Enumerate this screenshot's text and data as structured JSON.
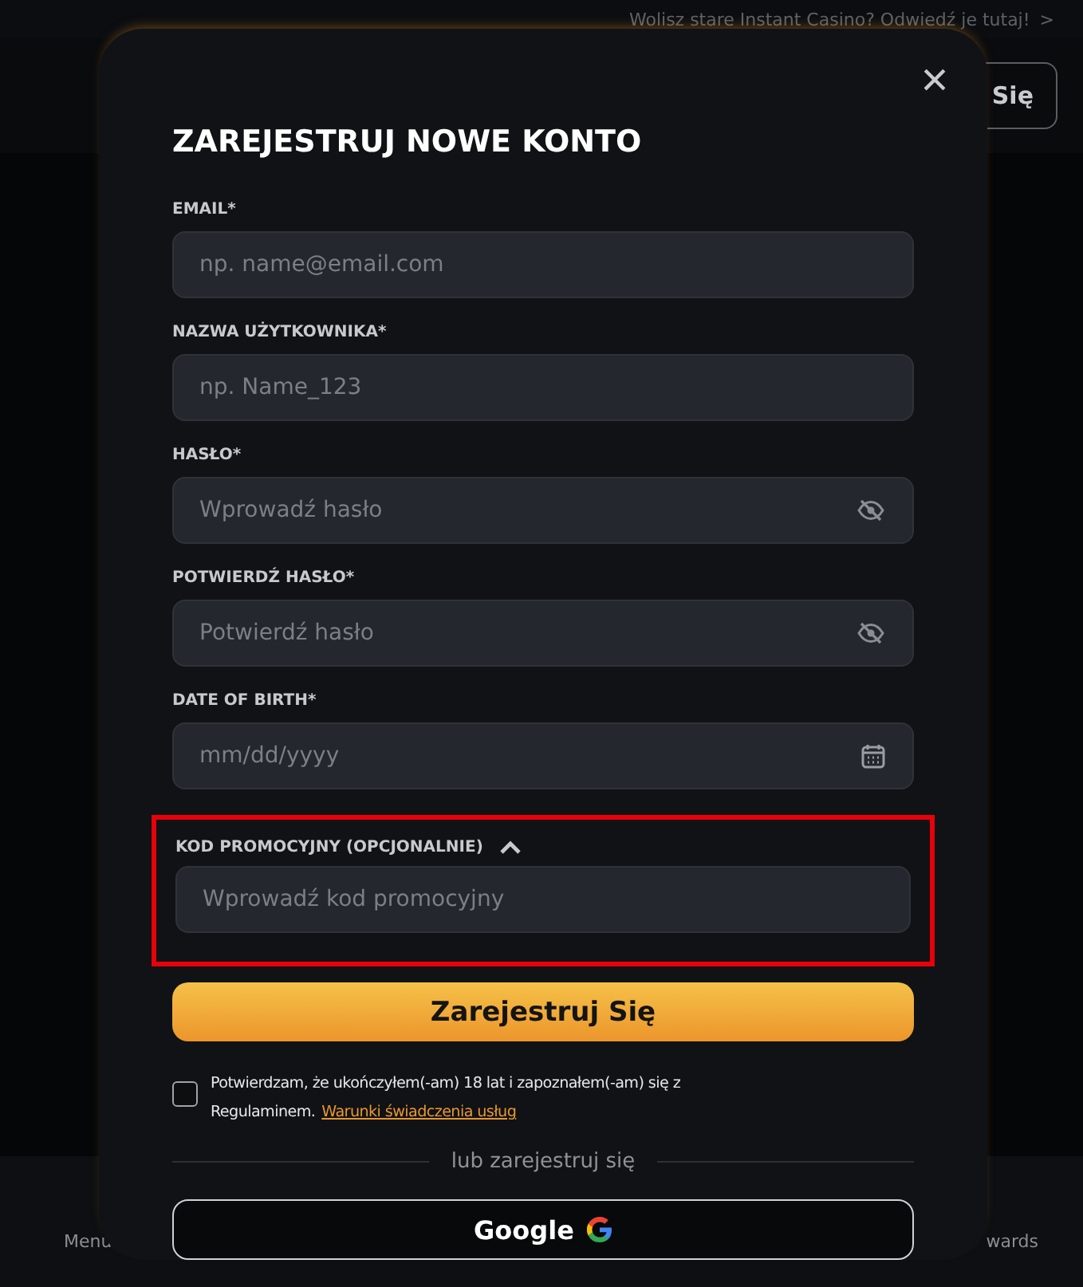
{
  "top_bar": {
    "link": "Wolisz stare Instant Casino? Odwiedź je tutaj!",
    "chevron": ">"
  },
  "header": {
    "button": "Się"
  },
  "bottom_nav": [
    "Menu",
    "wards"
  ],
  "modal": {
    "title": "ZAREJESTRUJ NOWE KONTO",
    "close": "×",
    "fields": [
      {
        "kind": "text",
        "label": "EMAIL*",
        "placeholder": "np. name@email.com"
      },
      {
        "kind": "text",
        "label": "NAZWA UŻYTKOWNIKA*",
        "placeholder": "np. Name_123"
      },
      {
        "kind": "password",
        "label": "HASŁO*",
        "placeholder": "Wprowadź hasło"
      },
      {
        "kind": "password",
        "label": "POTWIERDŹ HASŁO*",
        "placeholder": "Potwierdź hasło"
      },
      {
        "kind": "date",
        "label": "DATE OF BIRTH*",
        "placeholder": "mm/dd/yyyy"
      }
    ],
    "promo": {
      "label": "KOD PROMOCYJNY (OPCJONALNIE)",
      "expanded": true,
      "highlighted": true,
      "placeholder": "Wprowadź kod promocyjny"
    },
    "submit": "Zarejestruj Się",
    "consent": {
      "checked": false,
      "text": "Potwierdzam, że ukończyłem(-am) 18 lat i zapoznałem(-am) się z Regulaminem.",
      "link": "Warunki świadczenia usług"
    },
    "divider": "lub zarejestruj się",
    "google": "Google"
  }
}
